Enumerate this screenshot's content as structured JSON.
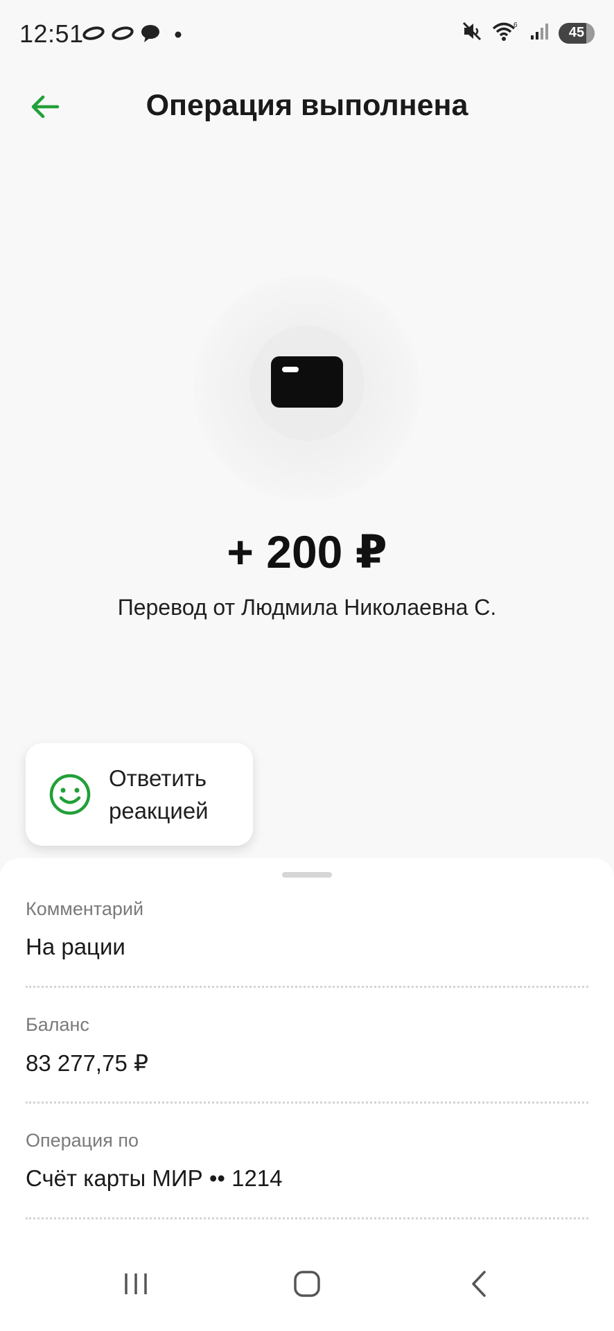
{
  "status_bar": {
    "time": "12:51",
    "battery": "45",
    "left_icons": [
      "link-icon",
      "link-icon",
      "chat-bubble-icon",
      "dot-icon"
    ],
    "right_icons": [
      "mute-vibrate-icon",
      "wifi-6-icon",
      "signal-icon",
      "battery-icon"
    ]
  },
  "header": {
    "title": "Операция выполнена",
    "back_icon": "arrow-left-icon"
  },
  "accent_color": "#21a038",
  "operation": {
    "icon": "card-icon",
    "amount": "+ 200 ₽",
    "description": "Перевод от Людмила Николаевна С."
  },
  "reaction": {
    "icon": "smiley-icon",
    "label": "Ответить реакцией"
  },
  "details": [
    {
      "label": "Комментарий",
      "value": "На рации"
    },
    {
      "label": "Баланс",
      "value": "83 277,75 ₽"
    },
    {
      "label": "Операция по",
      "value": "Счёт карты МИР •• 1214"
    }
  ],
  "nav_bar": {
    "buttons": [
      "recent-apps-icon",
      "home-icon",
      "back-chevron-icon"
    ]
  }
}
